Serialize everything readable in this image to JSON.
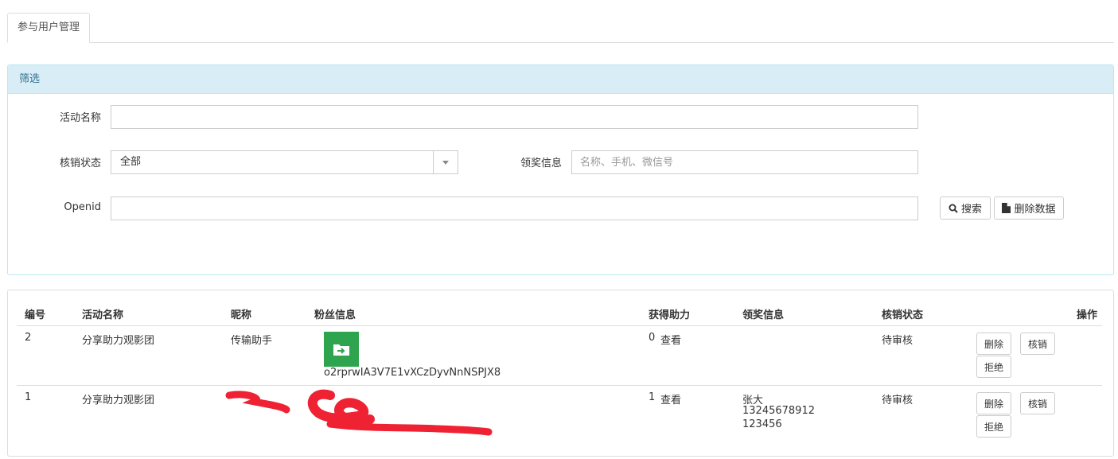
{
  "tabs": [
    {
      "label": "参与用户管理"
    }
  ],
  "filter": {
    "heading": "筛选",
    "activity_name_label": "活动名称",
    "activity_name_value": "",
    "status_label": "核销状态",
    "status_selected": "全部",
    "prize_info_label": "领奖信息",
    "prize_info_placeholder": "名称、手机、微信号",
    "openid_label": "Openid",
    "openid_value": "",
    "search_button": "搜索",
    "delete_data_button": "删除数据"
  },
  "table": {
    "headers": [
      "编号",
      "活动名称",
      "昵称",
      "粉丝信息",
      "获得助力",
      "领奖信息",
      "核销状态",
      "操作"
    ],
    "rows": [
      {
        "id": "2",
        "activity": "分享助力观影团",
        "nickname": "传输助手",
        "openid": "o2rprwIA3V7E1vXCzDyvNnNSPJX8",
        "help_count": "0",
        "view_link": "查看",
        "prize_lines": [],
        "status": "待审核",
        "actions": [
          "删除",
          "核销",
          "拒绝"
        ]
      },
      {
        "id": "1",
        "activity": "分享助力观影团",
        "nickname": "",
        "openid": "",
        "help_count": "1",
        "view_link": "查看",
        "prize_lines": [
          "张大",
          "13245678912",
          "123456"
        ],
        "status": "待审核",
        "actions": [
          "删除",
          "核销",
          "拒绝"
        ]
      }
    ]
  },
  "colors": {
    "panel_heading_bg": "#d9edf7",
    "avatar_green": "#2ea44f",
    "redaction_red": "#ee2233"
  },
  "icons": [
    "search-icon",
    "file-icon",
    "folder-arrow-icon"
  ]
}
